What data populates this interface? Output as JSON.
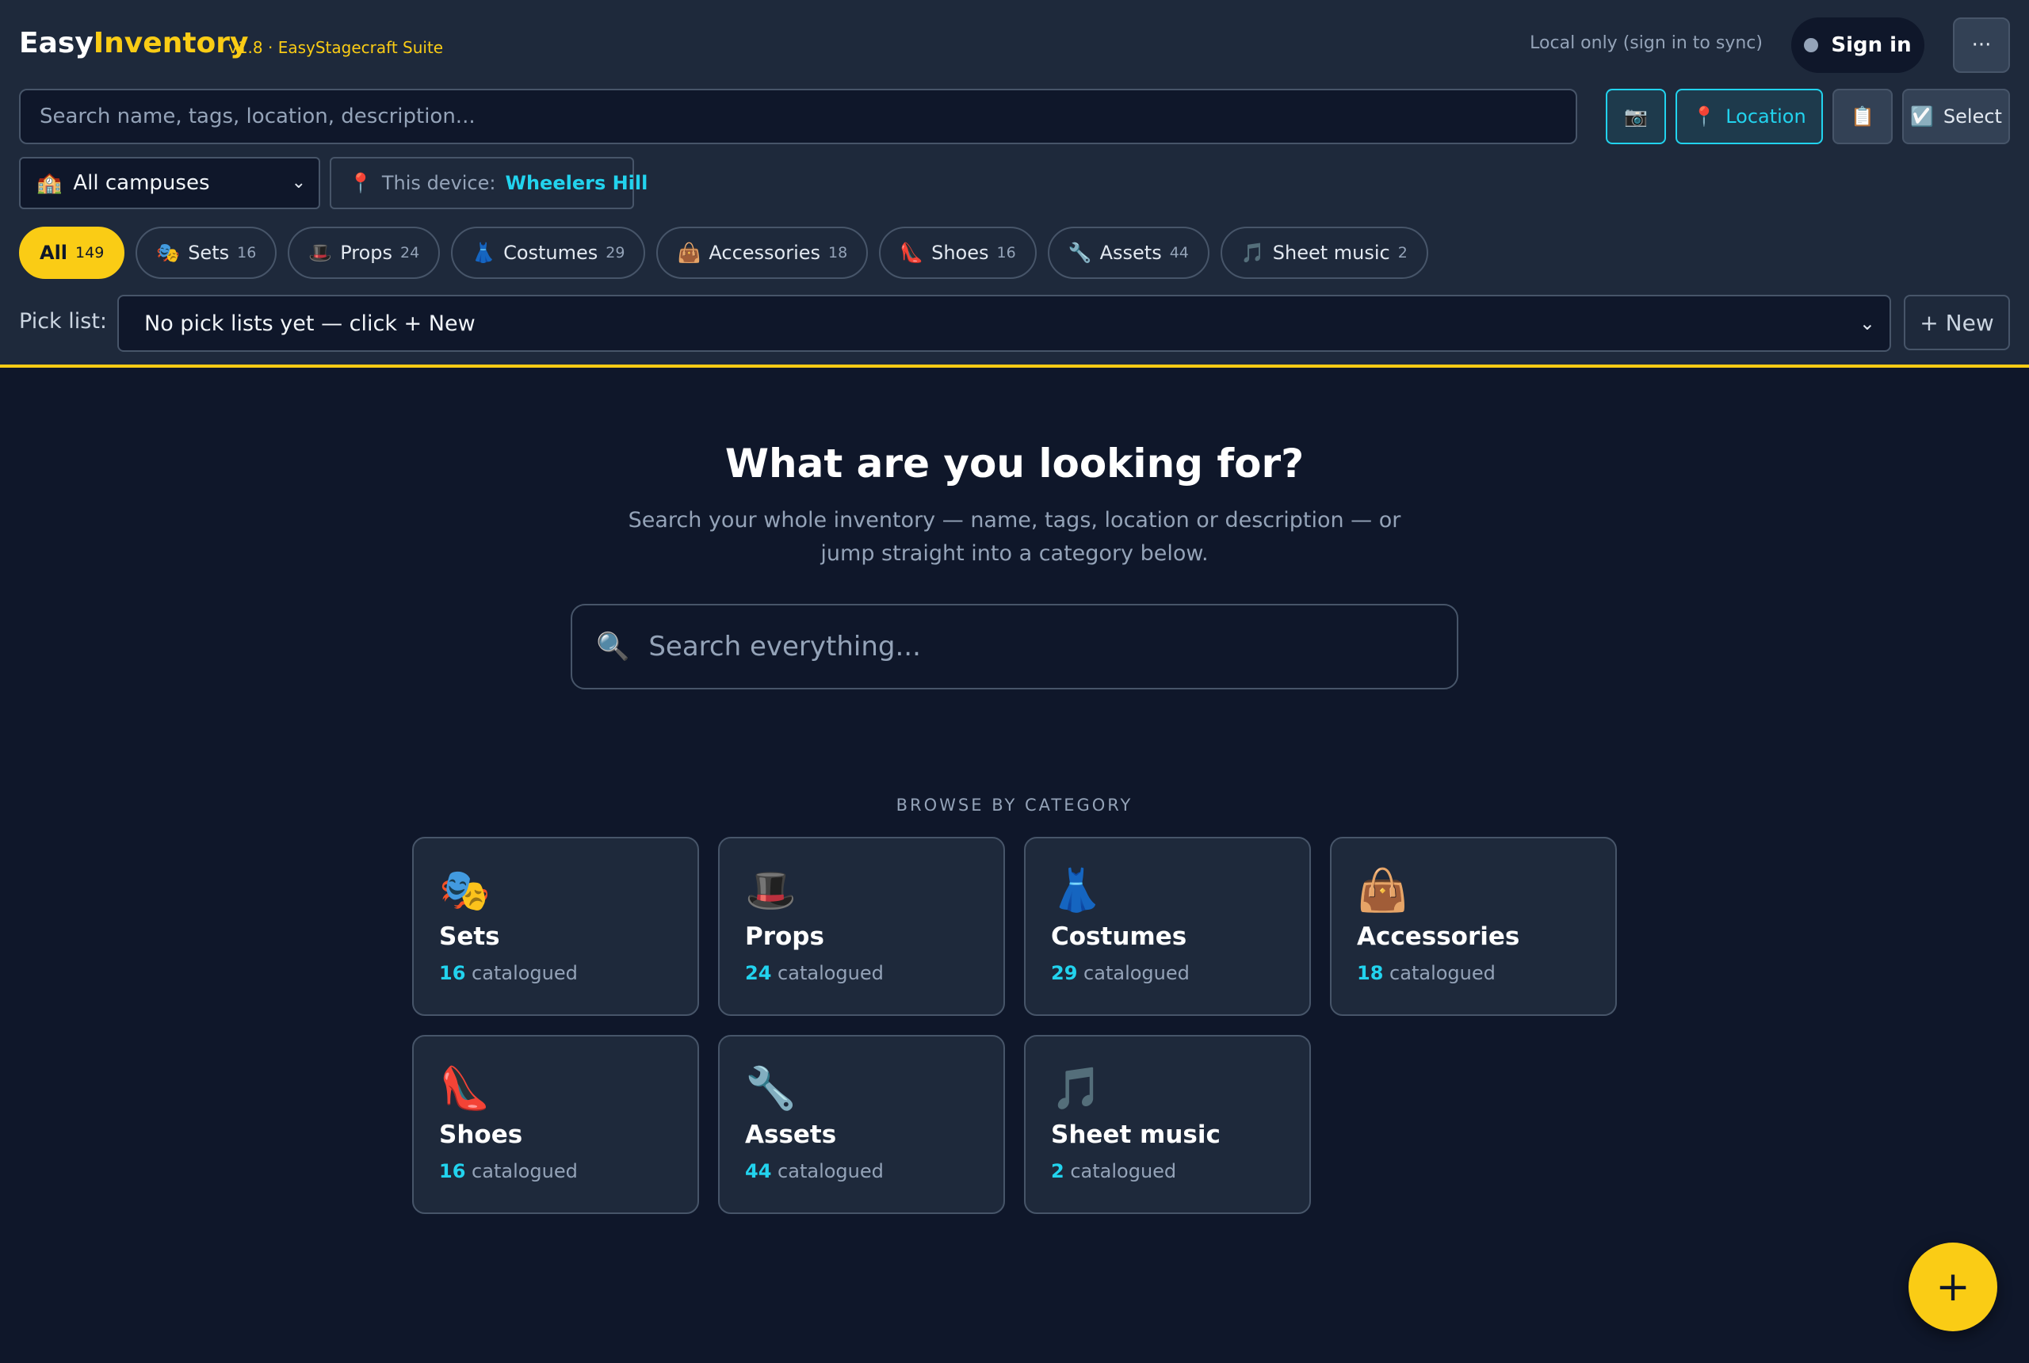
{
  "app": {
    "name_part1": "Easy",
    "name_part2": "Inventory",
    "version": "v1.8 · EasyStagecraft Suite",
    "sync_status": "Local only (sign in to sync)",
    "signin_label": "Sign in",
    "more_label": "···"
  },
  "toolbar": {
    "search_placeholder": "Search name, tags, location, description...",
    "camera_icon": "📷",
    "location_icon": "📍",
    "location_label": "Location",
    "clipboard_icon": "📋",
    "select_icon": "☑️",
    "select_label": "Select"
  },
  "filters": {
    "campus_icon": "🏫",
    "campus_value": "All campuses",
    "device_icon": "📍",
    "device_prefix": "This device:",
    "device_name": "Wheelers Hill"
  },
  "categories": [
    {
      "label": "All",
      "count": "149",
      "icon": ""
    },
    {
      "label": "Sets",
      "count": "16",
      "icon": "🎭"
    },
    {
      "label": "Props",
      "count": "24",
      "icon": "🎩"
    },
    {
      "label": "Costumes",
      "count": "29",
      "icon": "👗"
    },
    {
      "label": "Accessories",
      "count": "18",
      "icon": "👜"
    },
    {
      "label": "Shoes",
      "count": "16",
      "icon": "👠"
    },
    {
      "label": "Assets",
      "count": "44",
      "icon": "🔧"
    },
    {
      "label": "Sheet music",
      "count": "2",
      "icon": "🎵"
    }
  ],
  "picklist": {
    "label": "Pick list:",
    "value": "No pick lists yet — click + New",
    "new_label": "+ New"
  },
  "hero": {
    "title": "What are you looking for?",
    "subtitle": "Search your whole inventory — name, tags, location or description — or jump straight into a category below.",
    "search_icon": "🔍",
    "search_placeholder": "Search everything..."
  },
  "browse": {
    "label": "BROWSE BY CATEGORY",
    "suffix": "catalogued",
    "cards": [
      {
        "emoji": "🎭",
        "name": "Sets",
        "count": "16"
      },
      {
        "emoji": "🎩",
        "name": "Props",
        "count": "24"
      },
      {
        "emoji": "👗",
        "name": "Costumes",
        "count": "29"
      },
      {
        "emoji": "👜",
        "name": "Accessories",
        "count": "18"
      },
      {
        "emoji": "👠",
        "name": "Shoes",
        "count": "16"
      },
      {
        "emoji": "🔧",
        "name": "Assets",
        "count": "44"
      },
      {
        "emoji": "🎵",
        "name": "Sheet music",
        "count": "2"
      }
    ]
  },
  "fab": {
    "label": "+"
  },
  "colors": {
    "accent": "#facc15",
    "link": "#22d3ee",
    "background": "#0f172a",
    "panel": "#1e293b"
  }
}
